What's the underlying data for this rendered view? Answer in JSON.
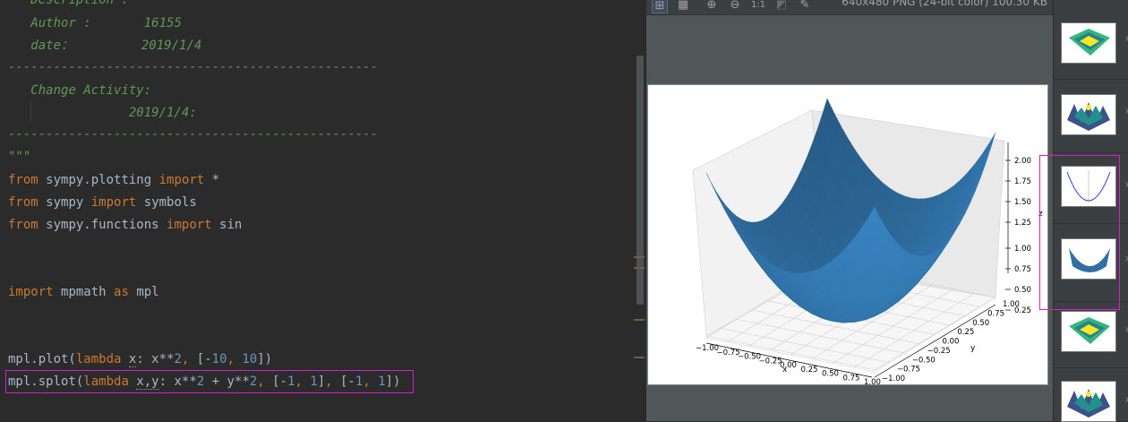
{
  "editor": {
    "docstring": {
      "description_label": "Description :",
      "author_label": "Author :",
      "author_value": "16155",
      "date_label": "date：",
      "date_value": "2019/1/4",
      "separator": "-------------------------------------------------",
      "change_activity_label": "Change Activity:",
      "change_date": "2019/1/4:",
      "close_quotes": "\"\"\""
    },
    "imports": [
      {
        "kw1": "from",
        "module": "sympy.plotting",
        "kw2": "import",
        "name": "*"
      },
      {
        "kw1": "from",
        "module": "sympy",
        "kw2": "import",
        "name": "symbols"
      },
      {
        "kw1": "from",
        "module": "sympy.functions",
        "kw2": "import",
        "name": "sin"
      }
    ],
    "import_mpmath": {
      "kw1": "import",
      "module": "mpmath",
      "kw2": "as",
      "alias": "mpl"
    },
    "code": {
      "line1": {
        "call": "mpl.plot(",
        "lambda": "lambda",
        "var": "x",
        "colon": ": x**",
        "exp": "2",
        "comma1": ", [-",
        "lo": "10",
        "comma2": ", ",
        "hi": "10",
        "end": "])"
      },
      "line2": {
        "call": "mpl.splot(",
        "lambda": "lambda",
        "vars": "x,y",
        "colon": ": x**",
        "exp1": "2",
        "plus": " + y**",
        "exp2": "2",
        "c1": ", [-",
        "a1": "1",
        "c2": ", ",
        "b1": "1",
        "c3": "], [-",
        "a2": "1",
        "c4": ", ",
        "b2": "1",
        "end": "])"
      }
    }
  },
  "viewer": {
    "toolbar_icons": [
      "fit-grid-icon",
      "grid-icon",
      "zoom-in-icon",
      "zoom-out-icon",
      "actual-size-icon",
      "background-icon",
      "color-picker-icon"
    ],
    "toolbar_glyphs": [
      "⊞",
      "▦",
      "⊕",
      "⊖",
      "1:1",
      "◩",
      "✎"
    ],
    "image_info": "640x480 PNG (24-bit color) 100.30 KB"
  },
  "chart_data": {
    "type": "surface",
    "xlabel": "x",
    "ylabel": "y",
    "zlabel": "z",
    "x_ticks": [
      "−1.00",
      "−0.75",
      "−0.50",
      "−0.25",
      "0.00",
      "0.25",
      "0.50",
      "0.75",
      "1.00"
    ],
    "y_ticks": [
      "−1.00",
      "−0.75",
      "−0.50",
      "−0.25",
      "0.00",
      "0.25",
      "0.50",
      "0.75",
      "1.00"
    ],
    "z_ticks": [
      "0.25",
      "0.50",
      "0.75",
      "1.00",
      "1.25",
      "1.50",
      "1.75",
      "2.00"
    ],
    "xlim": [
      -1,
      1
    ],
    "ylim": [
      -1,
      1
    ],
    "zlim": [
      0,
      2
    ],
    "surface_color": "#2f6fa3"
  },
  "thumbnails": [
    {
      "name": "thumb-surface-viridis"
    },
    {
      "name": "thumb-surface-peaks"
    },
    {
      "name": "thumb-parabola-2d"
    },
    {
      "name": "thumb-surface-blue"
    },
    {
      "name": "thumb-surface-viridis-2"
    },
    {
      "name": "thumb-surface-peaks-2"
    }
  ]
}
